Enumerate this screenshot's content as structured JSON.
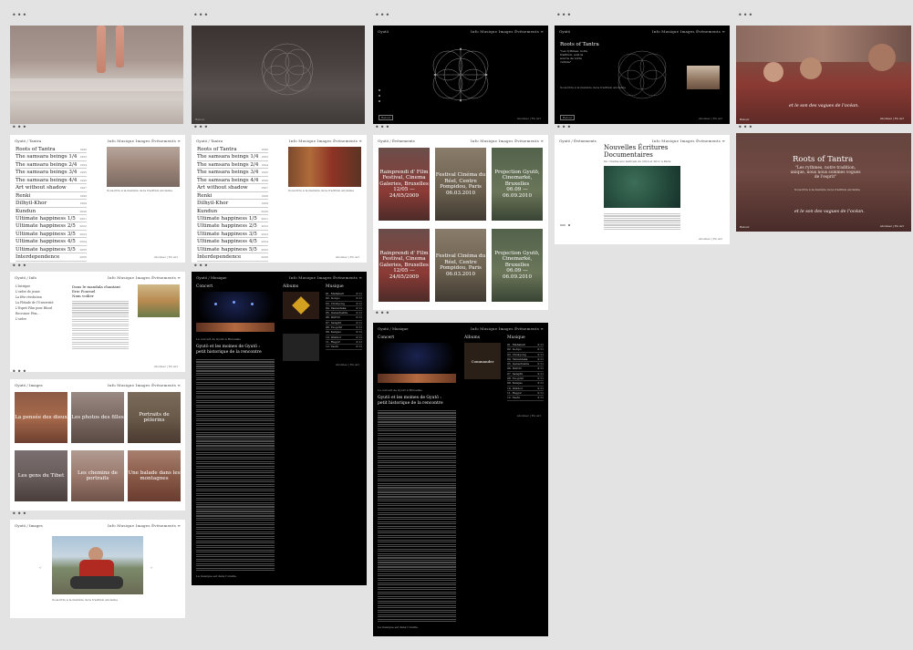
{
  "dots": "•••",
  "header": {
    "brand_tantra": "Gyutö / Tantra",
    "brand_info": "Gyutö / Info",
    "brand_images": "Gyutö / Images",
    "brand_musique": "Gyutö / Musique",
    "brand_evenements": "Gyutö / Événements",
    "brand_short": "Gyutö",
    "nav": "Info   Musique   Images   Événements   ≡"
  },
  "footer": "Abonnez  |  En Avr",
  "tantra_list": [
    {
      "label": "Roots of Tantra",
      "date": "1990"
    },
    {
      "label": "The samsara beings 1/4",
      "date": "1993"
    },
    {
      "label": "The samsara beings 2/4",
      "date": "1994"
    },
    {
      "label": "The samsara beings 3/4",
      "date": "1995"
    },
    {
      "label": "The samsara beings 4/4",
      "date": "1996"
    },
    {
      "label": "Art without shadow",
      "date": "1997"
    },
    {
      "label": "Renki",
      "date": "1998"
    },
    {
      "label": "Dilhyil-Khor",
      "date": "1999"
    },
    {
      "label": "Kundun",
      "date": "2000"
    },
    {
      "label": "Ultimate happiness 1/5",
      "date": "2001"
    },
    {
      "label": "Ultimate happiness 2/5",
      "date": "2002"
    },
    {
      "label": "Ultimate happiness 3/5",
      "date": "2003"
    },
    {
      "label": "Ultimate happiness 4/5",
      "date": "2004"
    },
    {
      "label": "Ultimate happiness 5/5",
      "date": "2005"
    },
    {
      "label": "Interdependence",
      "date": "2006"
    }
  ],
  "hero": {
    "roots_title": "Roots of Tantra",
    "roots_quote_small": "\"Les rythmes, notre tradition, sont la source de notre culture\"",
    "roots_quote_big": "\"Les rythmes, notre tradition, unique, nous nous sommes vogues de l'esprit\"",
    "roots_meta": "Sous-titre à la manière de la tradition ancienne",
    "caption_sound": "et le son des vagues de l'océan.",
    "tag": "Retour"
  },
  "events": [
    {
      "title": "Rainprendi d' Film Festival, Cinema Galeries, Bruxelles",
      "date": "12/05 — 24/05/2009"
    },
    {
      "title": "Festival Cinéma du Réel, Centre Pompidou, Paris",
      "date": "06.03.2010"
    },
    {
      "title": "Projection Gyutö, Cinemarké, Bruxelles",
      "date": "06.09 — 06.09.2010"
    }
  ],
  "nouvelles": {
    "title": "Nouvelles Écritures Documentaires",
    "subtitle": "Du cinéma aux festivals du 2010 et 2011 à Paris"
  },
  "info": {
    "nav": [
      "L'Intrigue",
      "L'ordre de jeune",
      "La fête révolution",
      "La Pléiade de l'Université",
      "L'Esprit Film pour Blood",
      "Recroiser Fém...",
      "L'ordre"
    ],
    "title_lines": [
      "Dans le mandala chantant",
      "Erie Fournel",
      "Nam voilier"
    ]
  },
  "images_tiles": [
    "La pensée des dieux",
    "Les photos des filles",
    "Portraits de pèlerins",
    "Les gens du Tibet",
    "Les chemins de portraits",
    "Une balade dans les montagnes"
  ],
  "musique": {
    "col_concert": "Concert",
    "col_albums": "Albums",
    "col_musique": "Musique",
    "article_title": "Gyutö et les moines de Gyutö : petit historique de la rencontre",
    "caption": "Le concert de Gyutö à Bruxelles",
    "tracks": [
      "01. Mahakali",
      "02. Gonpo",
      "03. Chökyong",
      "04. Yamantaka",
      "05. Ganachakra",
      "06. Dürtrö",
      "07. Sangdü",
      "08. Tsogchö",
      "09. Kangso",
      "10. Dükhor",
      "11. Rapjor",
      "12. Tashi"
    ],
    "track_time": "2:11",
    "commander": "Commander",
    "footer_note": "La musique est dans l'oreille."
  }
}
